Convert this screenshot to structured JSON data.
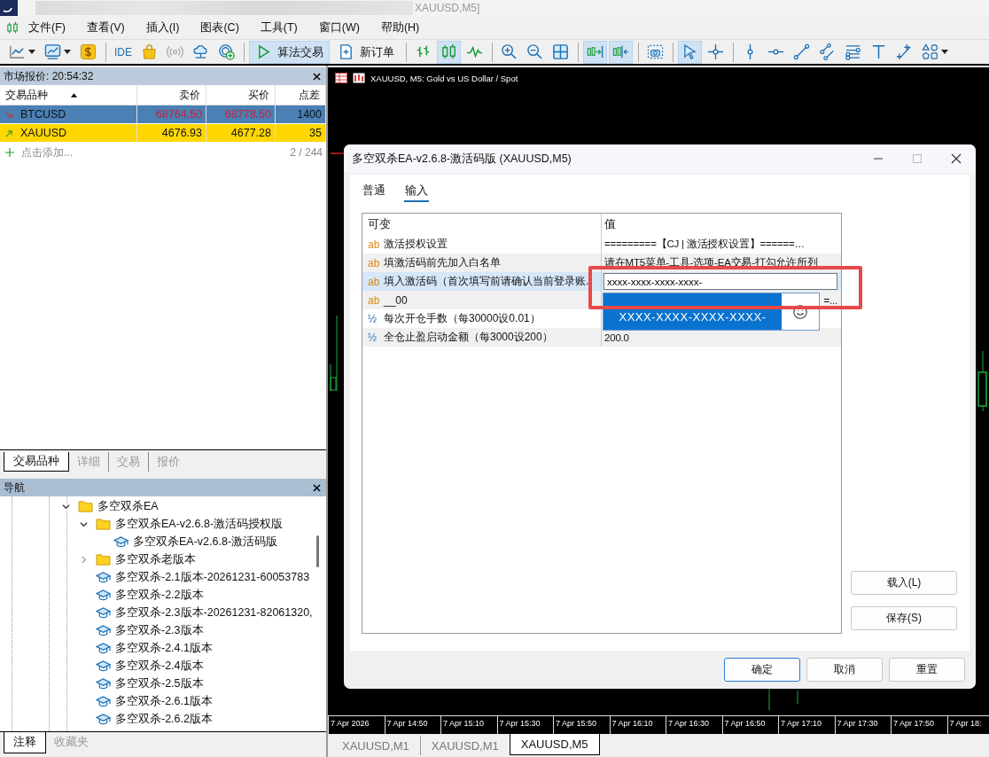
{
  "window": {
    "title": "XAUUSD,M5]"
  },
  "menu": [
    "文件(F)",
    "查看(V)",
    "插入(I)",
    "图表(C)",
    "工具(T)",
    "窗口(W)",
    "帮助(H)"
  ],
  "toolbar": {
    "ide": "IDE",
    "algo_trading": {
      "label": "算法交易",
      "active": true
    },
    "new_order": {
      "label": "新订单"
    },
    "bar_chart_active": false,
    "candle_chart_active": true,
    "line_chart_active": false,
    "autoscroll_active": true,
    "chart_shift_active": true,
    "cursor_active": true,
    "crosshair_active": false
  },
  "market_watch": {
    "title": "市场报价: 20:54:32",
    "columns": [
      "交易品种",
      "卖价",
      "买价",
      "点差"
    ],
    "rows": [
      {
        "symbol": "BTCUSD",
        "bid": "68764.50",
        "ask": "68778.50",
        "spread": "1400",
        "kind": "down",
        "color": "#4a80b4"
      },
      {
        "symbol": "XAUUSD",
        "bid": "4676.93",
        "ask": "4677.28",
        "spread": "35",
        "kind": "up",
        "color": "#ffd700"
      }
    ],
    "add_label": "点击添加...",
    "count": "2 / 244",
    "tabs": [
      {
        "label": "交易品种",
        "selected": true
      },
      {
        "label": "详细",
        "selected": false
      },
      {
        "label": "交易",
        "selected": false
      },
      {
        "label": "报价",
        "selected": false
      }
    ]
  },
  "navigator": {
    "title": "导航",
    "tree": [
      {
        "kind": "folder",
        "label": "多空双杀EA",
        "expanded": true,
        "children": [
          {
            "kind": "folder",
            "label": "多空双杀EA-v2.6.8-激活码授权版",
            "expanded": true,
            "children": [
              {
                "kind": "expert",
                "label": "多空双杀EA-v2.6.8-激活码版"
              }
            ]
          },
          {
            "kind": "folder",
            "label": "多空双杀老版本",
            "expanded": false
          },
          {
            "kind": "expert",
            "label": "多空双杀-2.1版本-20261231-60053783"
          },
          {
            "kind": "expert",
            "label": "多空双杀-2.2版本"
          },
          {
            "kind": "expert",
            "label": "多空双杀-2.3版本-20261231-82061320,"
          },
          {
            "kind": "expert",
            "label": "多空双杀-2.3版本"
          },
          {
            "kind": "expert",
            "label": "多空双杀-2.4.1版本"
          },
          {
            "kind": "expert",
            "label": "多空双杀-2.4版本"
          },
          {
            "kind": "expert",
            "label": "多空双杀-2.5版本"
          },
          {
            "kind": "expert",
            "label": "多空双杀-2.6.1版本"
          },
          {
            "kind": "expert",
            "label": "多空双杀-2.6.2版本"
          }
        ]
      }
    ],
    "tabs": [
      {
        "label": "注释",
        "selected": true
      },
      {
        "label": "收藏夹",
        "selected": false
      }
    ]
  },
  "chart": {
    "header": "XAUUSD, M5:  Gold vs US Dollar / Spot",
    "time_labels": [
      "7 Apr 2026",
      "7 Apr 14:50",
      "7 Apr 15:10",
      "7 Apr 15:30",
      "7 Apr 15:50",
      "7 Apr 16:10",
      "7 Apr 16:30",
      "7 Apr 16:50",
      "7 Apr 17:10",
      "7 Apr 17:30",
      "7 Apr 17:50",
      "7 Apr 18:"
    ],
    "tabs": [
      {
        "label": "XAUUSD,M1",
        "selected": false
      },
      {
        "label": "XAUUSD,M1",
        "selected": false
      },
      {
        "label": "XAUUSD,M5",
        "selected": true
      }
    ]
  },
  "dialog": {
    "title": "多空双杀EA-v2.6.8-激活码版 (XAUUSD,M5)",
    "tabs": [
      {
        "label": "普通",
        "selected": false
      },
      {
        "label": "输入",
        "selected": true
      }
    ],
    "columns": [
      "可变",
      "值"
    ],
    "params": [
      {
        "kind": "string",
        "type_label": "ab",
        "name": "激活授权设置",
        "value": "=========【CJ | 激活授权设置】======…",
        "selected": false
      },
      {
        "kind": "string",
        "type_label": "ab",
        "name": "填激活码前先加入白名单",
        "value": "请在MT5菜单-工具-选项-EA交易-打勾允许所列",
        "selected": false
      },
      {
        "kind": "string",
        "type_label": "ab",
        "name": "填入激活码（首次填写前请确认当前登录账.",
        "value": "xxxx-xxxx-xxxx-xxxx-",
        "editing": true,
        "selected": true
      },
      {
        "kind": "string",
        "type_label": "ab",
        "name": "__00",
        "value": "=...",
        "selected": false
      },
      {
        "kind": "number",
        "type_label": "½",
        "name": "每次开仓手数（每30000设0.01）",
        "selected": false
      },
      {
        "kind": "number",
        "type_label": "½",
        "name": "全仓止盈启动金额（每3000设200）",
        "value": "200.0",
        "selected": false
      }
    ],
    "suggestion": "XXXX-XXXX-XXXX-XXXX-",
    "side_buttons": [
      "载入(L)",
      "保存(S)"
    ],
    "buttons": [
      {
        "label": "确定",
        "default": true
      },
      {
        "label": "取消",
        "default": false
      },
      {
        "label": "重置",
        "default": false
      }
    ]
  }
}
